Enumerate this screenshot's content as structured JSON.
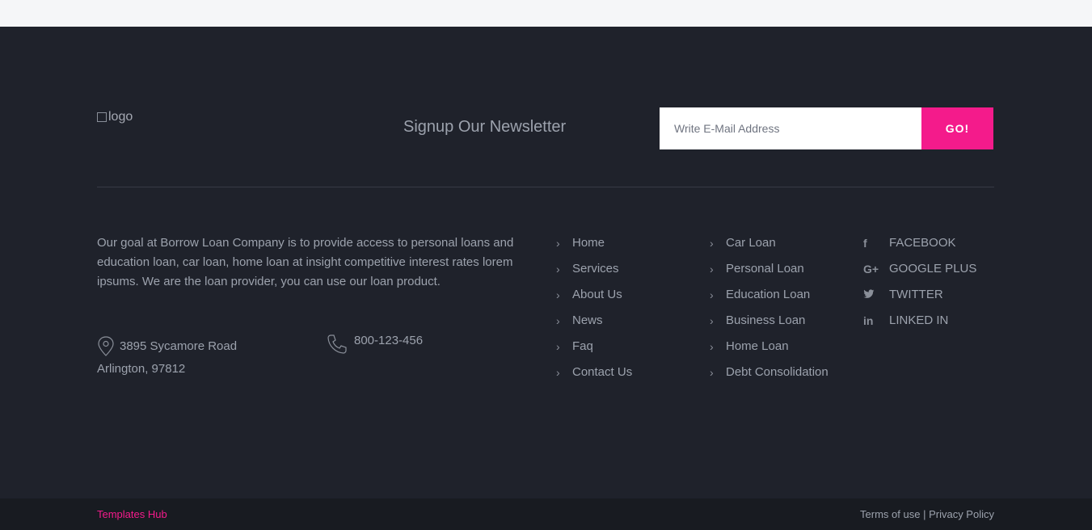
{
  "logo": {
    "alt_text": "logo"
  },
  "newsletter": {
    "title": "Signup Our Newsletter",
    "email_placeholder": "Write E-Mail Address",
    "submit_label": "GO!"
  },
  "about": {
    "text": "Our goal at Borrow Loan Company is to provide access to personal loans and education loan, car loan, home loan at insight competitive interest rates lorem ipsums. We are the loan provider, you can use our loan product."
  },
  "contact": {
    "address_line1": "3895 Sycamore Road",
    "address_line2": "Arlington, 97812",
    "phone": "800-123-456"
  },
  "main_links": [
    {
      "label": "Home"
    },
    {
      "label": "Services"
    },
    {
      "label": "About Us"
    },
    {
      "label": "News"
    },
    {
      "label": "Faq"
    },
    {
      "label": "Contact Us"
    }
  ],
  "loan_links": [
    {
      "label": "Car Loan"
    },
    {
      "label": "Personal Loan"
    },
    {
      "label": "Education Loan"
    },
    {
      "label": "Business Loan"
    },
    {
      "label": "Home Loan"
    },
    {
      "label": "Debt Consolidation"
    }
  ],
  "social": [
    {
      "label": "FACEBOOK",
      "icon": "facebook-icon",
      "glyph": "f"
    },
    {
      "label": "GOOGLE PLUS",
      "icon": "google-plus-icon",
      "glyph": "G+"
    },
    {
      "label": "TWITTER",
      "icon": "twitter-icon",
      "glyph": "🐦"
    },
    {
      "label": "LINKED IN",
      "icon": "linkedin-icon",
      "glyph": "in"
    }
  ],
  "bottom": {
    "brand": "Templates Hub",
    "terms": "Terms of use",
    "separator": "|",
    "privacy": "Privacy Policy"
  },
  "colors": {
    "accent": "#f41b8b",
    "footer_bg": "#1f222b",
    "bottom_bg": "#181b21",
    "text": "#9ca2ad"
  }
}
